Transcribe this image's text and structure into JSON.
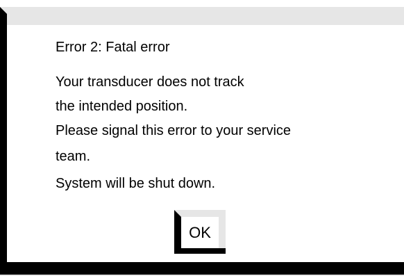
{
  "dialog": {
    "title": "Error 2: Fatal error",
    "message_lines": [
      "Your transducer does not track",
      "the intended position.",
      "Please signal this error to your service",
      "team.",
      "System will be shut down."
    ],
    "ok_label": "OK"
  },
  "colors": {
    "background": "#ffffff",
    "bevel_light": "#e6e6e6",
    "bevel_dark": "#000000",
    "text": "#000000"
  }
}
